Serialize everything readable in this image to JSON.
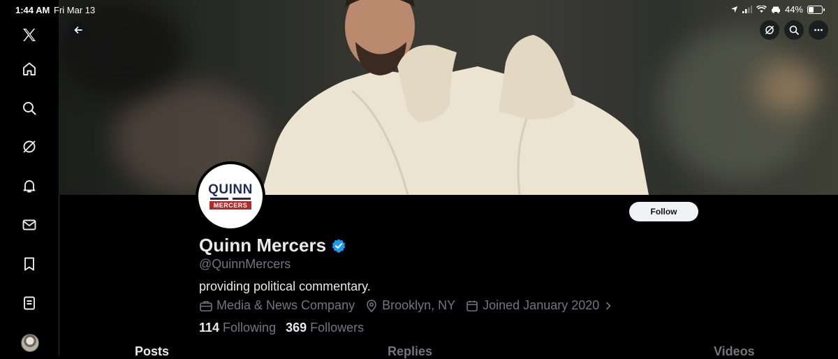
{
  "status_bar": {
    "time": "1:44 AM",
    "date": "Fri Mar 13",
    "battery": "44%",
    "battery_level": 0.44
  },
  "sidebar": {
    "items": [
      {
        "icon": "x-logo-icon"
      },
      {
        "icon": "home-icon"
      },
      {
        "icon": "search-icon"
      },
      {
        "icon": "grok-icon"
      },
      {
        "icon": "bell-icon"
      },
      {
        "icon": "mail-icon"
      },
      {
        "icon": "bookmark-icon"
      },
      {
        "icon": "list-icon"
      },
      {
        "icon": "avatar"
      }
    ]
  },
  "header": {
    "back_icon": "arrow-left-icon",
    "actions": [
      "grok-icon",
      "search-icon",
      "more-icon"
    ]
  },
  "profile": {
    "avatar_logo_top": "QUINN",
    "avatar_logo_bottom": "MERCERS",
    "follow_label": "Follow",
    "name": "Quinn Mercers",
    "verified": true,
    "handle": "@QuinnMercers",
    "bio": "providing political commentary.",
    "category": "Media & News Company",
    "location": "Brooklyn, NY",
    "joined": "Joined January 2020",
    "following_count": "114",
    "following_label": "Following",
    "followers_count": "369",
    "followers_label": "Followers"
  },
  "tabs": [
    {
      "label": "Posts"
    },
    {
      "label": "Replies"
    },
    {
      "label": "Videos"
    }
  ],
  "colors": {
    "background": "#000000",
    "verified": "#1d9bf0",
    "muted": "#71767b",
    "text": "#e7e9ea",
    "follow_bg": "#eff3f4"
  }
}
